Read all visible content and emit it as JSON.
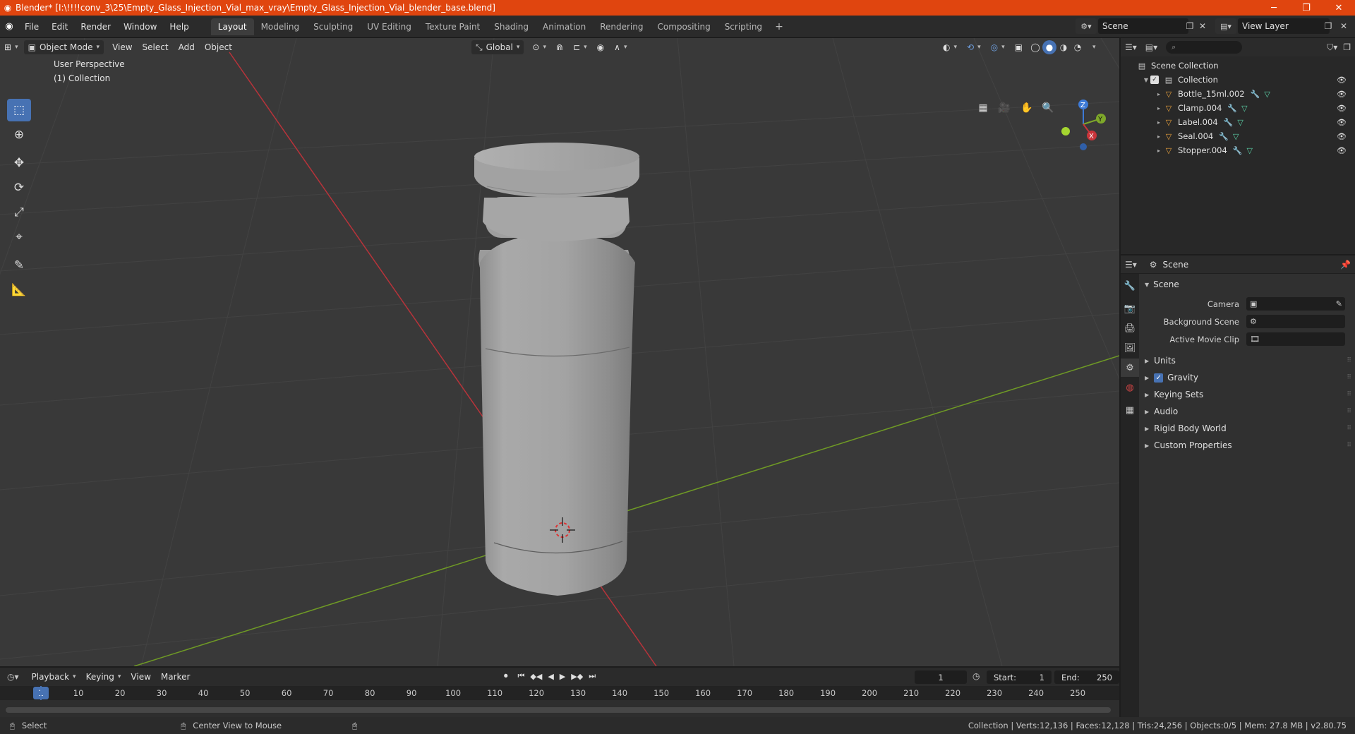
{
  "window": {
    "title": "Blender* [I:\\!!!!conv_3\\25\\Empty_Glass_Injection_Vial_max_vray\\Empty_Glass_Injection_Vial_blender_base.blend]"
  },
  "menu": [
    "File",
    "Edit",
    "Render",
    "Window",
    "Help"
  ],
  "workspaces": [
    "Layout",
    "Modeling",
    "Sculpting",
    "UV Editing",
    "Texture Paint",
    "Shading",
    "Animation",
    "Rendering",
    "Compositing",
    "Scripting"
  ],
  "active_workspace": "Layout",
  "scene_name": "Scene",
  "view_layer": "View Layer",
  "viewport": {
    "mode": "Object Mode",
    "menus": [
      "View",
      "Select",
      "Add",
      "Object"
    ],
    "transform_orientation": "Global",
    "overlay_title": "User Perspective",
    "overlay_collection": "(1) Collection",
    "axis_labels": {
      "z": "Z",
      "y": "Y",
      "x": "X"
    }
  },
  "outliner": {
    "root": "Scene Collection",
    "collection": "Collection",
    "objects": [
      "Bottle_15ml.002",
      "Clamp.004",
      "Label.004",
      "Seal.004",
      "Stopper.004"
    ]
  },
  "properties": {
    "context": "Scene",
    "panel_title": "Scene",
    "fields": [
      {
        "label": "Camera",
        "value": ""
      },
      {
        "label": "Background Scene",
        "value": ""
      },
      {
        "label": "Active Movie Clip",
        "value": ""
      }
    ],
    "subpanels": [
      "Units",
      "Gravity",
      "Keying Sets",
      "Audio",
      "Rigid Body World",
      "Custom Properties"
    ],
    "gravity_enabled": true
  },
  "timeline": {
    "menus": [
      "Playback",
      "Keying",
      "View",
      "Marker"
    ],
    "current_frame": "1",
    "start_label": "Start:",
    "start": "1",
    "end_label": "End:",
    "end": "250",
    "ruler": [
      "10",
      "20",
      "30",
      "40",
      "50",
      "60",
      "70",
      "80",
      "90",
      "100",
      "110",
      "120",
      "130",
      "140",
      "150",
      "160",
      "170",
      "180",
      "190",
      "200",
      "210",
      "220",
      "230",
      "240",
      "250"
    ],
    "ruler_current": "1"
  },
  "statusbar": {
    "select": "Select",
    "center_view": "Center View to Mouse",
    "stats": "Collection | Verts:12,136 | Faces:12,128 | Tris:24,256 | Objects:0/5 | Mem: 27.8 MB | v2.80.75"
  },
  "colors": {
    "titlebar": "#e0450f",
    "accent": "#4772b3",
    "viewport_bg": "#393939",
    "x_axis": "#c9343a",
    "y_axis": "#7ea82a",
    "z_axis": "#3d7ad6"
  }
}
